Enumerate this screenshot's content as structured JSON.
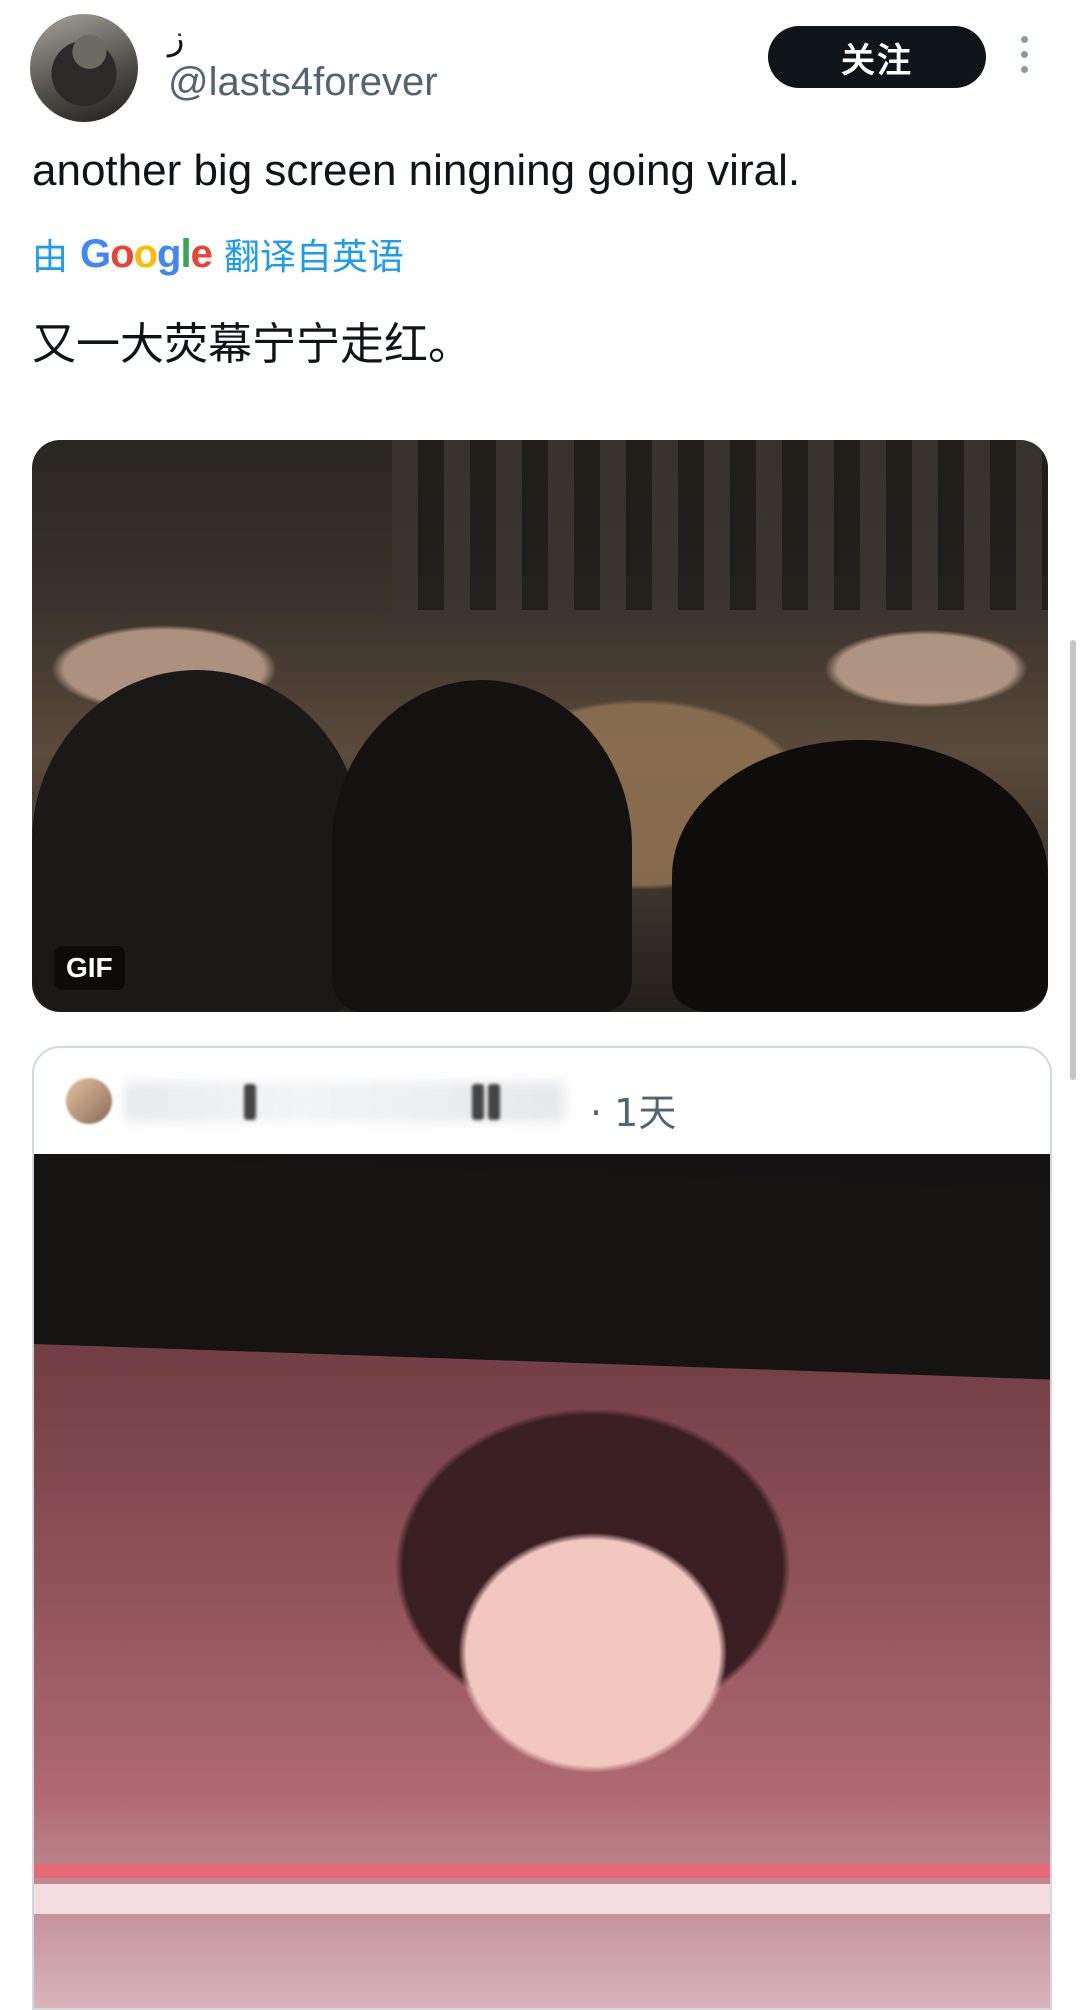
{
  "author": {
    "display_name": "ز",
    "handle": "@lasts4forever"
  },
  "follow_button": {
    "label": "关注"
  },
  "more_icon": "more-vertical-icon",
  "tweet": {
    "text": "another big screen ningning going viral.",
    "translate": {
      "prefix": "由",
      "provider": "Google",
      "suffix": "翻译自英语"
    },
    "translated_text": "又一大荧幕宁宁走红。"
  },
  "media": {
    "badge": "GIF"
  },
  "quoted_tweet": {
    "time": "· 1天"
  },
  "colors": {
    "accent": "#1d9bf0",
    "text_primary": "#0f1419",
    "text_secondary": "#536471",
    "button_bg": "#0f1419",
    "border": "#cfd9de"
  }
}
